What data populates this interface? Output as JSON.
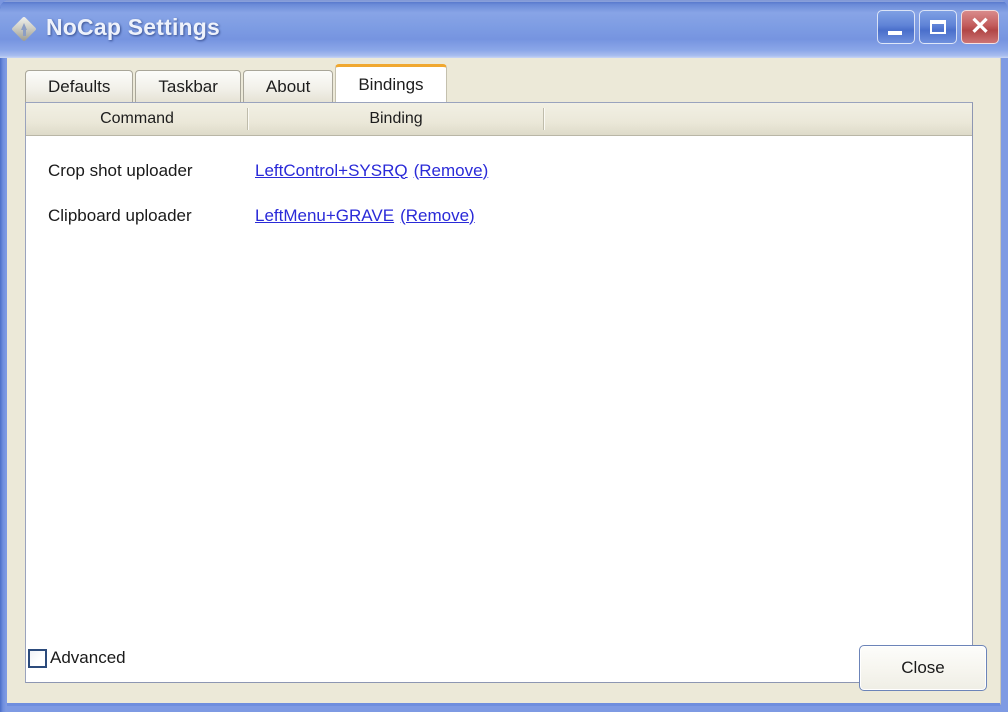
{
  "window": {
    "title": "NoCap Settings",
    "icon": "diamond-arrow-icon",
    "controls": {
      "minimize_label": "_",
      "maximize_label": "□",
      "close_label": "✕"
    },
    "accent_title_start": "#4a6cc4",
    "accent_title_end": "#c9d6f4",
    "dialog_bg": "#ece9d8",
    "active_tab_accent": "#f0a830",
    "link_color": "#2a2ad8"
  },
  "tabs": [
    {
      "label": "Defaults",
      "active": false
    },
    {
      "label": "Taskbar",
      "active": false
    },
    {
      "label": "About",
      "active": false
    },
    {
      "label": "Bindings",
      "active": true
    }
  ],
  "bindings_list": {
    "columns": [
      "Command",
      "Binding",
      ""
    ],
    "rows": [
      {
        "command": "Crop shot uploader",
        "binding": "LeftControl+SYSRQ",
        "remove_label": "(Remove)"
      },
      {
        "command": "Clipboard uploader",
        "binding": "LeftMenu+GRAVE",
        "remove_label": "(Remove)"
      }
    ]
  },
  "footer": {
    "advanced_label": "Advanced",
    "advanced_checked": false,
    "close_label": "Close"
  }
}
